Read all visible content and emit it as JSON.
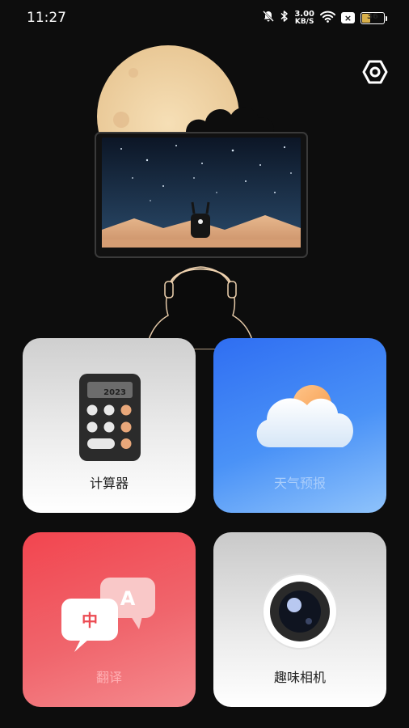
{
  "status_bar": {
    "time": "11:27",
    "net_speed_value": "3.00",
    "net_speed_unit": "KB/S",
    "battery_level": "36",
    "icons": [
      "bell-muted-icon",
      "bluetooth-icon",
      "wifi-icon",
      "close-badge-icon",
      "battery-icon"
    ]
  },
  "settings": {
    "icon": "settings-icon"
  },
  "tiles": [
    {
      "label": "计算器",
      "icon": "calculator-icon"
    },
    {
      "label": "天气预报",
      "icon": "weather-icon"
    },
    {
      "label": "翻译",
      "icon": "translate-icon"
    },
    {
      "label": "趣味相机",
      "icon": "camera-icon"
    }
  ],
  "illustration": {
    "calc_display": "2023",
    "translate_char_1": "中",
    "translate_char_2": "A"
  },
  "colors": {
    "background": "#0d0d0d",
    "weather_accent": "#2f6ef2",
    "translate_accent": "#f2454f",
    "battery_fill": "#d9b04a"
  }
}
